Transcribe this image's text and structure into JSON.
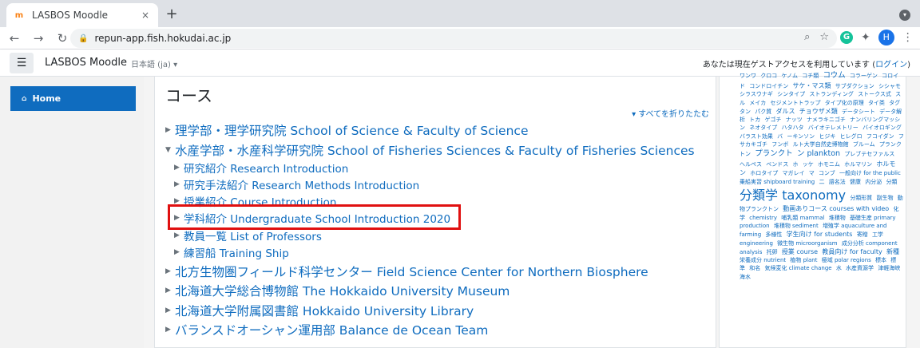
{
  "browser": {
    "tab_title": "LASBOS Moodle",
    "tab_close": "×",
    "new_tab": "+",
    "url": "repun-app.fish.hokudai.ac.jp",
    "profile_initial": "H",
    "ext_g": "G"
  },
  "navbar": {
    "brand": "LASBOS Moodle",
    "language": "日本語 (ja) ▾",
    "guest_text": "あなたは現在ゲストアクセスを利用しています (",
    "login_link": "ログイン",
    "guest_close": ")"
  },
  "drawer": {
    "home_label": "Home"
  },
  "main": {
    "title": "コース",
    "collapse_all": "▾ すべてを折りたたむ",
    "categories": [
      {
        "label": "理学部・理学研究院 School of Science & Faculty of Science",
        "arrow": "▶"
      },
      {
        "label": "水産学部・水産科学研究院 School of Fisheries Sciences & Faculty of Fisheries Sciences",
        "arrow": "▼"
      },
      {
        "label": "研究紹介 Research Introduction",
        "arrow": "▶"
      },
      {
        "label": "研究手法紹介 Research Methods Introduction",
        "arrow": "▶"
      },
      {
        "label": "授業紹介 Course Introduction",
        "arrow": "▶"
      },
      {
        "label": "学科紹介 Undergraduate School Introduction 2020",
        "arrow": "▶"
      },
      {
        "label": "教員一覧 List of Professors",
        "arrow": "▶"
      },
      {
        "label": "練習船 Training Ship",
        "arrow": "▶"
      },
      {
        "label": "北方生物圏フィールド科学センター Field Science Center for Northern Biosphere",
        "arrow": "▶"
      },
      {
        "label": "北海道大学総合博物館 The Hokkaido University Museum",
        "arrow": "▶"
      },
      {
        "label": "北海道大学附属図書館 Hokkaido University Library",
        "arrow": "▶"
      },
      {
        "label": "バランスドオーシャン運用部 Balance de Ocean Team",
        "arrow": "▶"
      }
    ]
  },
  "tags": [
    {
      "t": "ワンワ",
      "s": "t-s"
    },
    {
      "t": "クロコ",
      "s": "t-s"
    },
    {
      "t": "ケノム",
      "s": "t-s"
    },
    {
      "t": "コチ類",
      "s": "t-s"
    },
    {
      "t": "コウム",
      "s": "t-l"
    },
    {
      "t": "コラーゲン",
      "s": "t-s"
    },
    {
      "t": "コロイ",
      "s": "t-s"
    },
    {
      "t": "ド",
      "s": "t-s"
    },
    {
      "t": "コンドロイチン",
      "s": "t-s"
    },
    {
      "t": "サケ・マス類",
      "s": "t-m"
    },
    {
      "t": "サブダクション",
      "s": "t-s"
    },
    {
      "t": "シシャモ",
      "s": "t-s"
    },
    {
      "t": "シラスウナギ",
      "s": "t-s"
    },
    {
      "t": "シンタイプ",
      "s": "t-s"
    },
    {
      "t": "ストランディング",
      "s": "t-s"
    },
    {
      "t": "ストークス式",
      "s": "t-s"
    },
    {
      "t": "スル",
      "s": "t-s"
    },
    {
      "t": "メイカ",
      "s": "t-s"
    },
    {
      "t": "セジメントトラップ",
      "s": "t-s"
    },
    {
      "t": "タイプ化の原理",
      "s": "t-s"
    },
    {
      "t": "タイ类",
      "s": "t-s"
    },
    {
      "t": "タグ",
      "s": "t-s"
    },
    {
      "t": "タン",
      "s": "t-s"
    },
    {
      "t": "パク質",
      "s": "t-s"
    },
    {
      "t": "ダルス",
      "s": "t-m"
    },
    {
      "t": "チョウザメ類",
      "s": "t-m"
    },
    {
      "t": "データシート",
      "s": "t-s"
    },
    {
      "t": "データ解析",
      "s": "t-s"
    },
    {
      "t": "トカ",
      "s": "t-s"
    },
    {
      "t": "ゲゴチ",
      "s": "t-s"
    },
    {
      "t": "ナッツ",
      "s": "t-s"
    },
    {
      "t": "ナメラキニゴチ",
      "s": "t-s"
    },
    {
      "t": "ナンバリングマッシン",
      "s": "t-s"
    },
    {
      "t": "ネオタイプ",
      "s": "t-s"
    },
    {
      "t": "ハタハタ",
      "s": "t-s"
    },
    {
      "t": "バイオテレメトリー",
      "s": "t-s"
    },
    {
      "t": "バイオロギング",
      "s": "t-s"
    },
    {
      "t": "バラスト効果",
      "s": "t-s"
    },
    {
      "t": "バ",
      "s": "t-s"
    },
    {
      "t": "ーキンソン",
      "s": "t-s"
    },
    {
      "t": "ヒジキ",
      "s": "t-s"
    },
    {
      "t": "ヒレグロ",
      "s": "t-s"
    },
    {
      "t": "フコイダン",
      "s": "t-s"
    },
    {
      "t": "フサカキゴチ",
      "s": "t-s"
    },
    {
      "t": "フンボ",
      "s": "t-s"
    },
    {
      "t": "ルト大学自然史博物館",
      "s": "t-s"
    },
    {
      "t": "ブルーム",
      "s": "t-s"
    },
    {
      "t": "プランクトン",
      "s": "t-s"
    },
    {
      "t": "プランクト",
      "s": "t-l"
    },
    {
      "t": "ン plankton",
      "s": "t-l"
    },
    {
      "t": "プレブテセファルス",
      "s": "t-s"
    },
    {
      "t": "ヘルペス",
      "s": "t-s"
    },
    {
      "t": "ベンドス",
      "s": "t-s"
    },
    {
      "t": "ホ",
      "s": "t-s"
    },
    {
      "t": "ッケ",
      "s": "t-s"
    },
    {
      "t": "ホモニム",
      "s": "t-s"
    },
    {
      "t": "ホルマリン",
      "s": "t-s"
    },
    {
      "t": "ホルモン",
      "s": "t-m"
    },
    {
      "t": "ホロタイプ",
      "s": "t-s"
    },
    {
      "t": "マガレイ",
      "s": "t-s"
    },
    {
      "t": "マ",
      "s": "t-s"
    },
    {
      "t": "コンブ",
      "s": "t-s"
    },
    {
      "t": "一般向け for the public",
      "s": "t-s"
    },
    {
      "t": "乗船実習 shipboard training",
      "s": "t-s"
    },
    {
      "t": "二",
      "s": "t-s"
    },
    {
      "t": "語名法",
      "s": "t-s"
    },
    {
      "t": "健康",
      "s": "t-s"
    },
    {
      "t": "内分泌",
      "s": "t-s"
    },
    {
      "t": "分類",
      "s": "t-s"
    },
    {
      "t": "分類学",
      "s": "t-xxl"
    },
    {
      "t": "taxonomy",
      "s": "t-xxl"
    },
    {
      "t": "分類形質",
      "s": "t-s"
    },
    {
      "t": "副生物",
      "s": "t-s"
    },
    {
      "t": "動物プランクトン",
      "s": "t-s"
    },
    {
      "t": "動画ありコース courses with video",
      "s": "t-m"
    },
    {
      "t": "化学",
      "s": "t-s"
    },
    {
      "t": "chemistry",
      "s": "t-s"
    },
    {
      "t": "哺乳類 mammal",
      "s": "t-s"
    },
    {
      "t": "堆積物",
      "s": "t-s"
    },
    {
      "t": "基礎生産 primary",
      "s": "t-s"
    },
    {
      "t": "production",
      "s": "t-s"
    },
    {
      "t": "堆積物 sediment",
      "s": "t-s"
    },
    {
      "t": "増殖学 aquaculture and",
      "s": "t-s"
    },
    {
      "t": "farming",
      "s": "t-s"
    },
    {
      "t": "多様性",
      "s": "t-s"
    },
    {
      "t": "学生向け for students",
      "s": "t-m"
    },
    {
      "t": "寄贈",
      "s": "t-s"
    },
    {
      "t": "工学",
      "s": "t-s"
    },
    {
      "t": "engineering",
      "s": "t-s"
    },
    {
      "t": "微生物 microorganism",
      "s": "t-s"
    },
    {
      "t": "成分分析 component",
      "s": "t-s"
    },
    {
      "t": "analysis",
      "s": "t-s"
    },
    {
      "t": "托卵",
      "s": "t-s"
    },
    {
      "t": "授業 course",
      "s": "t-m"
    },
    {
      "t": "教員向け for faculty",
      "s": "t-m"
    },
    {
      "t": "新種",
      "s": "t-m"
    },
    {
      "t": "栄養成分 nutrient",
      "s": "t-s"
    },
    {
      "t": "植物 plant",
      "s": "t-s"
    },
    {
      "t": "極域 polar regions",
      "s": "t-s"
    },
    {
      "t": "標本",
      "s": "t-s"
    },
    {
      "t": "標準",
      "s": "t-s"
    },
    {
      "t": "和名",
      "s": "t-s"
    },
    {
      "t": "気候変化 climate change",
      "s": "t-s"
    },
    {
      "t": "水",
      "s": "t-s"
    },
    {
      "t": "水産資源学",
      "s": "t-s"
    },
    {
      "t": "津軽海峡",
      "s": "t-s"
    },
    {
      "t": "海水",
      "s": "t-s"
    }
  ]
}
